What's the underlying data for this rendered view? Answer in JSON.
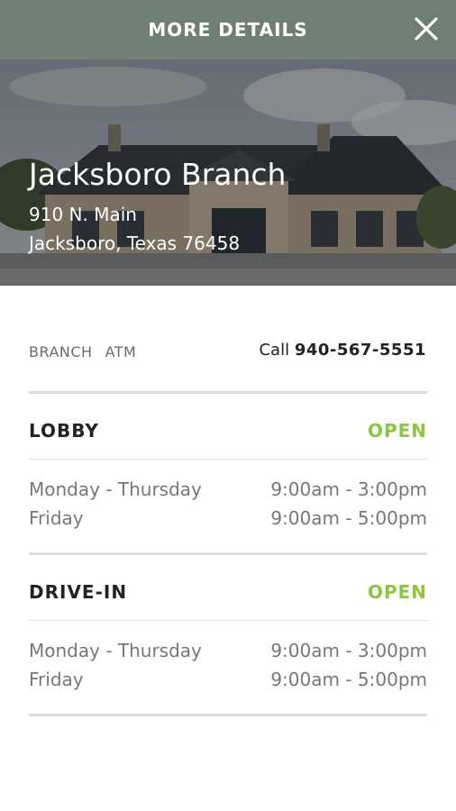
{
  "header": {
    "title": "MORE DETAILS"
  },
  "branch": {
    "name": "Jacksboro Branch",
    "address_line1": "910 N. Main",
    "address_line2": "Jacksboro, Texas 76458"
  },
  "tabs": [
    "BRANCH",
    "ATM"
  ],
  "contact": {
    "call_label": "Call",
    "phone": "940-567-5551"
  },
  "sections": [
    {
      "title": "LOBBY",
      "status": "OPEN",
      "rows": [
        {
          "day": "Monday - Thursday",
          "hours": "9:00am - 3:00pm"
        },
        {
          "day": "Friday",
          "hours": "9:00am - 5:00pm"
        }
      ]
    },
    {
      "title": "DRIVE-IN",
      "status": "OPEN",
      "rows": [
        {
          "day": "Monday - Thursday",
          "hours": "9:00am - 3:00pm"
        },
        {
          "day": "Friday",
          "hours": "9:00am - 5:00pm"
        }
      ]
    }
  ],
  "colors": {
    "header_bg": "#6f7f73",
    "open_status": "#8dc63f"
  },
  "icons": {
    "close": "close-icon"
  }
}
